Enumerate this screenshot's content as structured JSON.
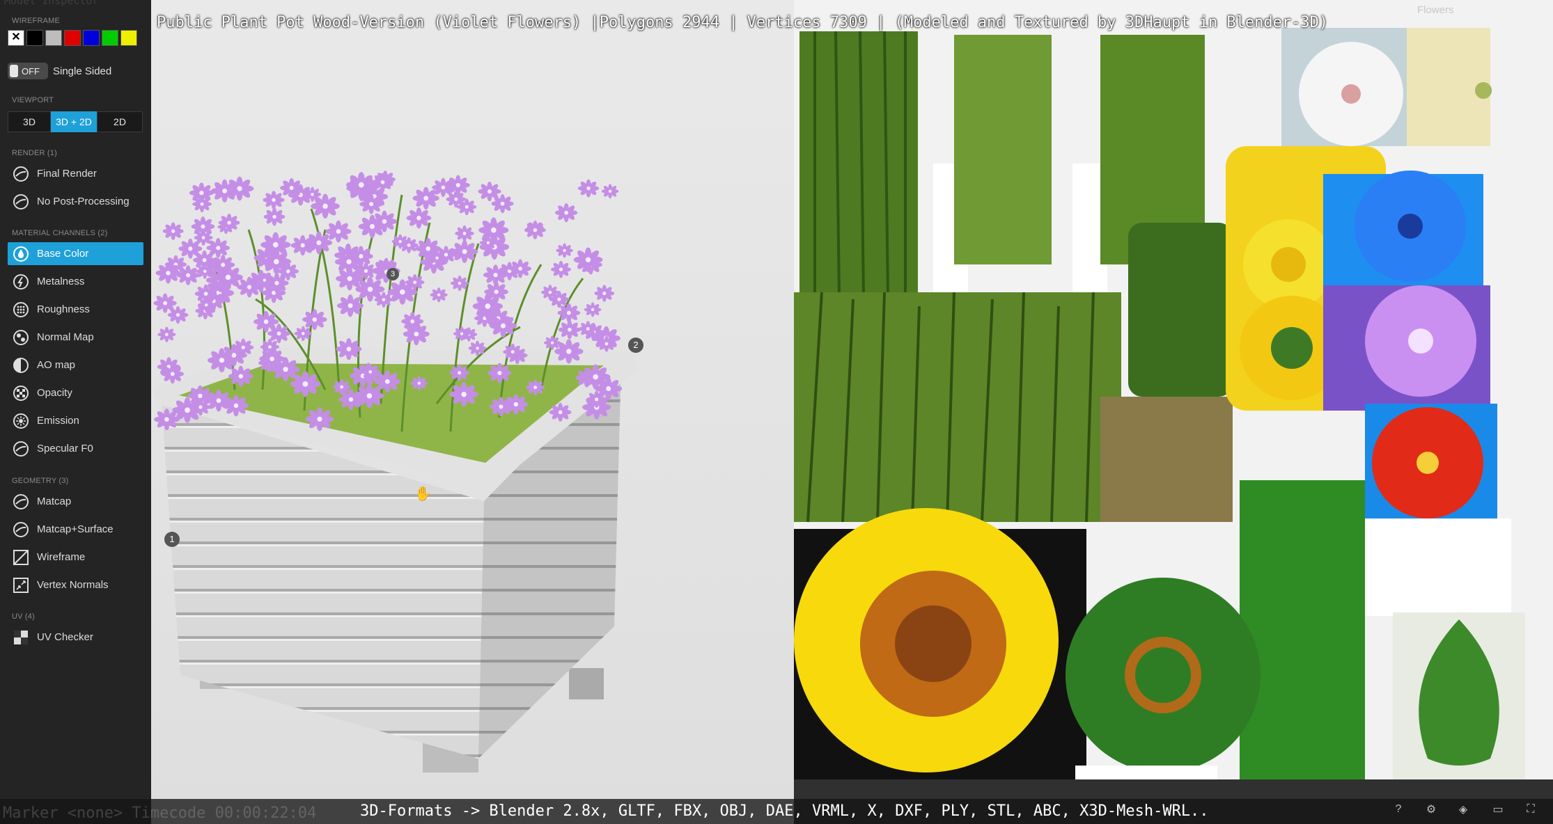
{
  "window": {
    "title": "Public Plant Pot Wood-Version (Violet Flowers) |Polygons 2944 | Vertices 7309 | (Modeled and Textured by 3DHaupt in Blender-3D)",
    "caption": "3D-Formats -> Blender 2.8x, GLTF, FBX, OBJ, DAE, VRML, X, DXF, PLY, STL, ABC, X3D-Mesh-WRL..",
    "ghost_top_left": "Model Inspector",
    "ghost_bottom_left": "Marker <none>   Timecode 00:00:22:04",
    "uv_panel_label": "Flowers"
  },
  "sidebar": {
    "wireframe_section": "Wireframe",
    "wireframe_colors": [
      "#ffffff",
      "#000000",
      "#bdbdbd",
      "#e00000",
      "#0000dd",
      "#00cc00",
      "#eeee00"
    ],
    "single_sided": {
      "toggle": "OFF",
      "label": "Single Sided"
    },
    "viewport_section": "Viewport",
    "viewport_buttons": [
      "3D",
      "3D + 2D",
      "2D"
    ],
    "viewport_selected": "3D + 2D",
    "render_section": "Render (1)",
    "render_items": [
      "Final Render",
      "No Post-Processing"
    ],
    "material_section": "Material Channels (2)",
    "material_items": [
      "Base Color",
      "Metalness",
      "Roughness",
      "Normal Map",
      "AO map",
      "Opacity",
      "Emission",
      "Specular F0"
    ],
    "material_selected": "Base Color",
    "geometry_section": "Geometry (3)",
    "geometry_items": [
      "Matcap",
      "Matcap+Surface",
      "Wireframe",
      "Vertex Normals"
    ],
    "uv_section": "UV (4)",
    "uv_items": [
      "UV Checker"
    ]
  },
  "viewport": {
    "annotations": [
      "1",
      "2",
      "3"
    ]
  },
  "colors": {
    "accent": "#1ea0d8",
    "sidebar_bg": "#242424",
    "flower_petal": "#c48ee6",
    "wood": "#d4d4d4"
  }
}
